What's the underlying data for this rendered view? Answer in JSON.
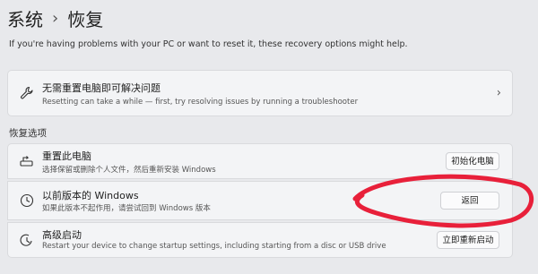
{
  "breadcrumb": {
    "parent": "系统",
    "separator": "›",
    "current": "恢复"
  },
  "intro": "If you're having problems with your PC or want to reset it, these recovery options might help.",
  "troubleshoot": {
    "title": "无需重置电脑即可解决问题",
    "subtitle": "Resetting can take a while — first, try resolving issues by running a troubleshooter",
    "chevron": "›",
    "icon": "wrench-icon"
  },
  "section_title": "恢复选项",
  "options": [
    {
      "title": "重置此电脑",
      "subtitle": "选择保留或删除个人文件，然后重新安装 Windows",
      "button": "初始化电脑",
      "icon": "reset-pc-icon"
    },
    {
      "title": "以前版本的 Windows",
      "subtitle": "如果此版本不起作用，请尝试回到 Windows 版本",
      "button": "返回",
      "icon": "history-icon"
    },
    {
      "title": "高级启动",
      "subtitle": "Restart your device to change startup settings, including starting from a disc or USB drive",
      "button": "立即重新启动",
      "icon": "advanced-startup-icon"
    }
  ],
  "colors": {
    "annotation": "#e8203a",
    "card": "#f3f4f6",
    "background": "#e8e9ec"
  }
}
